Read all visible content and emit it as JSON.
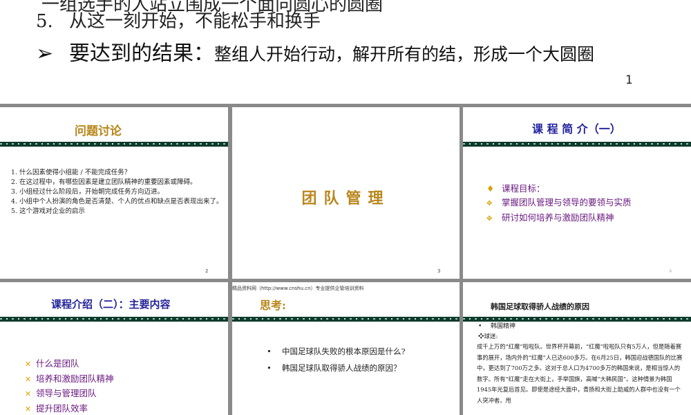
{
  "top_slide": {
    "cut_line": "一组选手的人站立围成一个面向圆心的圆圈",
    "item5_num": "5.",
    "item5_text": "从这一刻开始，不能松手和换手",
    "result_arrow": "➢",
    "result_label": "要达到的结果：",
    "result_text": "整组人开始行动，解开所有的结，形成一个大圆圈",
    "page_number": "1"
  },
  "slide2": {
    "title": "问题讨论",
    "items": [
      "什么因素使得小组能 / 不能完成任务？",
      "在这过程中，有哪些因素是建立团队精神的重要因素或障碍。",
      "小组经过什么阶段后，开始朝完成任务方向迈进。",
      "小组中个人扮演的角色是否清楚、个人的优点和缺点是否表现出来了。",
      "这个游戏对企业的启示"
    ],
    "page_number": "2"
  },
  "slide3": {
    "title": "团队管理",
    "page_number": "3"
  },
  "slide4": {
    "title": "课 程 简 介（一）",
    "goal_marker": "♦",
    "goal_label": "课程目标：",
    "sub_marker": "✥",
    "goals": [
      "掌握团队管理与领导的要领与实质",
      "研讨如何培养与激励团队精神"
    ],
    "page_number": "4"
  },
  "slide5": {
    "title": "课程介绍（二）：主要内容",
    "marker": "✕",
    "items": [
      "什么是团队",
      "培养和激励团队精神",
      "领导与管理团队",
      "提升团队效率"
    ]
  },
  "slide6": {
    "header": "精品资料网（http://www.cnshu.cn）专业提供企管培训资料",
    "title": "思考:",
    "bullet": "•",
    "items": [
      "中国足球队失败的根本原因是什么?",
      "韩国足球队取得骄人战绩的原因？"
    ]
  },
  "slide7": {
    "title": "韩国足球取得骄人战绩的原因",
    "bullet": "•",
    "spirit": "韩国精神",
    "subhead": "❖球迷:",
    "body": "成千上万的“红魔”啦啦队。世界杯开幕前，“红魔”啦啦队只有5万人，但是随着赛事的展开，场内外的“红魔”人已达600多万。在6月25日，韩国迎战德国队的比赛中，更达到了700万之多。这对于总人口为4700多万的韩国来说，是相当惊人的数字。所有“红魔”走在大街上，手举国旗，高喊“大韩民国”。这种情景为韩国1945年光复后首见。即使是途经大面中，青扬和大街上助威的人群中也没有一个人突冲者。甩"
  },
  "colors": {
    "gold": "#b8861b",
    "navy": "#1f1fa0",
    "purple": "#6a1a80",
    "band": "#0e3b2b",
    "background": "#8a8a8a"
  }
}
